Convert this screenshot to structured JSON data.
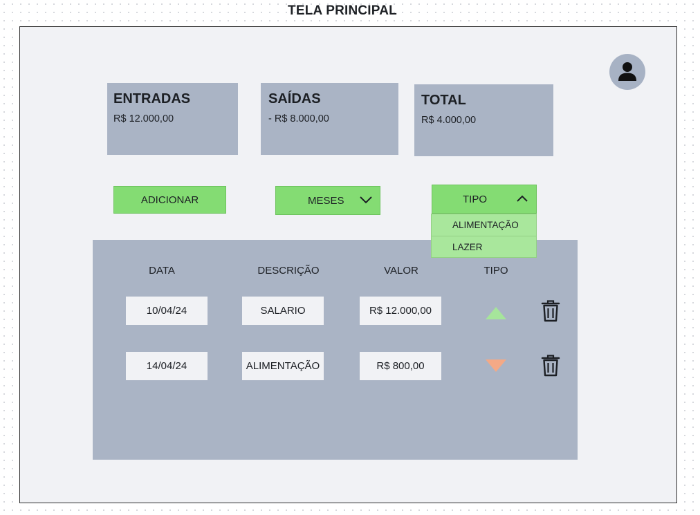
{
  "page": {
    "title": "TELA PRINCIPAL"
  },
  "header": {
    "avatar_icon": "user-icon"
  },
  "summary": {
    "entradas": {
      "title": "ENTRADAS",
      "value": "R$  12.000,00"
    },
    "saidas": {
      "title": "SAÍDAS",
      "value": "- R$  8.000,00"
    },
    "total": {
      "title": "TOTAL",
      "value": "R$ 4.000,00"
    }
  },
  "controls": {
    "add_label": "ADICIONAR",
    "months_label": "MESES",
    "months_icon": "chevron-down-icon",
    "type_label": "TIPO",
    "type_icon": "chevron-up-icon",
    "type_options": [
      "ALIMENTAÇÃO",
      "LAZER"
    ]
  },
  "table": {
    "headers": [
      "DATA",
      "DESCRIÇÃO",
      "VALOR",
      "TIPO"
    ],
    "rows": [
      {
        "date": "10/04/24",
        "description": "SALARIO",
        "value": "R$ 12.000,00",
        "type_icon": "arrow-up-icon",
        "delete_icon": "trash-icon"
      },
      {
        "date": "14/04/24",
        "description": "ALIMENTAÇÃO",
        "value": "R$ 800,00",
        "type_icon": "arrow-down-icon",
        "delete_icon": "trash-icon"
      }
    ]
  },
  "colors": {
    "button_green": "#84dc73",
    "dropdown_green": "#a9e79c",
    "panel_gray": "#aab4c5",
    "income_arrow": "#a6e59b",
    "expense_arrow": "#f4a986"
  }
}
